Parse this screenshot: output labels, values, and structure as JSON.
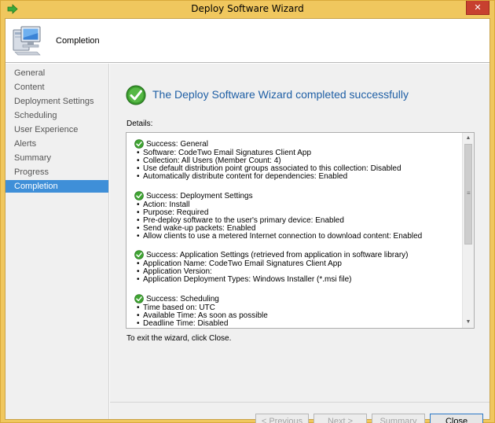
{
  "window": {
    "title": "Deploy Software Wizard",
    "close_label": "✕",
    "accent": "#f0c75e"
  },
  "header": {
    "page_title": "Completion"
  },
  "nav": {
    "items": [
      {
        "label": "General"
      },
      {
        "label": "Content"
      },
      {
        "label": "Deployment Settings"
      },
      {
        "label": "Scheduling"
      },
      {
        "label": "User Experience"
      },
      {
        "label": "Alerts"
      },
      {
        "label": "Summary"
      },
      {
        "label": "Progress"
      },
      {
        "label": "Completion",
        "selected": true
      }
    ],
    "selected_color": "#3f8fd8"
  },
  "main": {
    "headline": "The Deploy Software Wizard completed successfully",
    "details_label": "Details:",
    "exit_text": "To exit the wizard, click Close."
  },
  "details": {
    "sections": [
      {
        "title": "Success: General",
        "items": [
          "Software: CodeTwo Email Signatures Client App",
          "Collection: All Users (Member Count: 4)",
          "Use default distribution point groups associated to this collection: Disabled",
          "Automatically distribute content for dependencies: Enabled"
        ]
      },
      {
        "title": "Success: Deployment Settings",
        "items": [
          "Action: Install",
          "Purpose: Required",
          "Pre-deploy software to the user's primary device: Enabled",
          "Send wake-up packets: Enabled",
          "Allow clients to use a metered Internet connection to download content: Enabled"
        ]
      },
      {
        "title": "Success: Application Settings (retrieved from application in software library)",
        "items": [
          "Application Name: CodeTwo Email Signatures Client App",
          "Application Version:",
          "Application Deployment Types: Windows Installer (*.msi file)"
        ]
      },
      {
        "title": "Success: Scheduling",
        "items": [
          "Time based on: UTC",
          "Available Time: As soon as possible",
          "Deadline Time: Disabled"
        ]
      }
    ]
  },
  "buttons": {
    "previous": "< Previous",
    "next": "Next >",
    "summary": "Summary",
    "close": "Close"
  },
  "icons": {
    "window": "wizard-arrow-icon",
    "header": "computer-icon",
    "success": "green-check-icon"
  }
}
